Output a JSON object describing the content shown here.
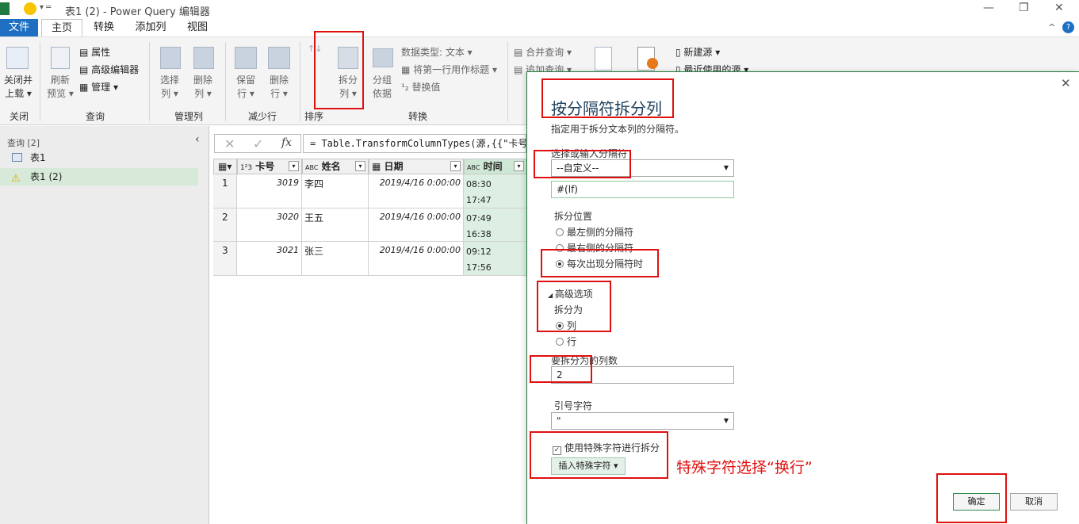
{
  "window": {
    "title": "表1 (2) - Power Query 编辑器",
    "minimize": "—",
    "restore": "❐",
    "close": "✕"
  },
  "tabs": [
    "文件",
    "主页",
    "转换",
    "添加列",
    "视图"
  ],
  "ribbon": {
    "close_load": [
      "关闭并",
      "上载 ▾"
    ],
    "refresh": [
      "刷新",
      "预览 ▾"
    ],
    "properties": "属性",
    "advanced_editor": "高级编辑器",
    "manage": "管理 ▾",
    "choose_cols": [
      "选择",
      "列 ▾"
    ],
    "remove_cols": [
      "删除",
      "列 ▾"
    ],
    "keep_rows": [
      "保留",
      "行 ▾"
    ],
    "remove_rows": [
      "删除",
      "行 ▾"
    ],
    "split_col": [
      "拆分",
      "列 ▾"
    ],
    "group_by": [
      "分组",
      "依据"
    ],
    "data_type": "数据类型: 文本 ▾",
    "first_row_header": "将第一行用作标题 ▾",
    "replace": "替换值",
    "merge_queries": "合并查询 ▾",
    "append_queries": "追加查询 ▾",
    "new_source": "新建源 ▾",
    "recent_sources": "最近使用的源 ▾",
    "groups": [
      "关闭",
      "查询",
      "管理列",
      "减少行",
      "排序",
      "转换"
    ]
  },
  "queries": {
    "header": "查询 [2]",
    "items": [
      "表1",
      "表1 (2)"
    ]
  },
  "formula": "= Table.TransformColumnTypes(源,{{\"卡号\",",
  "grid": {
    "columns": [
      {
        "type": "1²3",
        "name": "卡号"
      },
      {
        "type": "ABC",
        "name": "姓名"
      },
      {
        "type": "▦",
        "name": "日期"
      },
      {
        "type": "ABC",
        "name": "时间"
      }
    ],
    "rows": [
      {
        "n": "1",
        "card": "3019",
        "name": "李四",
        "date": "2019/4/16 0:00:00",
        "time1": "08:30",
        "time2": "17:47"
      },
      {
        "n": "2",
        "card": "3020",
        "name": "王五",
        "date": "2019/4/16 0:00:00",
        "time1": "07:49",
        "time2": "16:38"
      },
      {
        "n": "3",
        "card": "3021",
        "name": "张三",
        "date": "2019/4/16 0:00:00",
        "time1": "09:12",
        "time2": "17:56"
      }
    ]
  },
  "dialog": {
    "title": "按分隔符拆分列",
    "subtitle": "指定用于拆分文本列的分隔符。",
    "delimiter_label": "选择或输入分隔符",
    "delimiter_value": "--自定义--",
    "custom_value": "#(lf)",
    "split_at_label": "拆分位置",
    "split_options": [
      "最左侧的分隔符",
      "最右侧的分隔符",
      "每次出现分隔符时"
    ],
    "advanced": "高级选项",
    "split_into_label": "拆分为",
    "split_into": [
      "列",
      "行"
    ],
    "num_cols_label": "要拆分为的列数",
    "num_cols_value": "2",
    "quote_label": "引号字符",
    "quote_value": "\"",
    "special_chars_label": "使用特殊字符进行拆分",
    "insert_special": "插入特殊字符 ▾",
    "annotation": "特殊字符选择“换行”",
    "ok": "确定",
    "cancel": "取消"
  },
  "colors": {
    "file_tab": "#1e6fc2",
    "selected_col": "#dcefe2",
    "highlight": "#e01010"
  }
}
